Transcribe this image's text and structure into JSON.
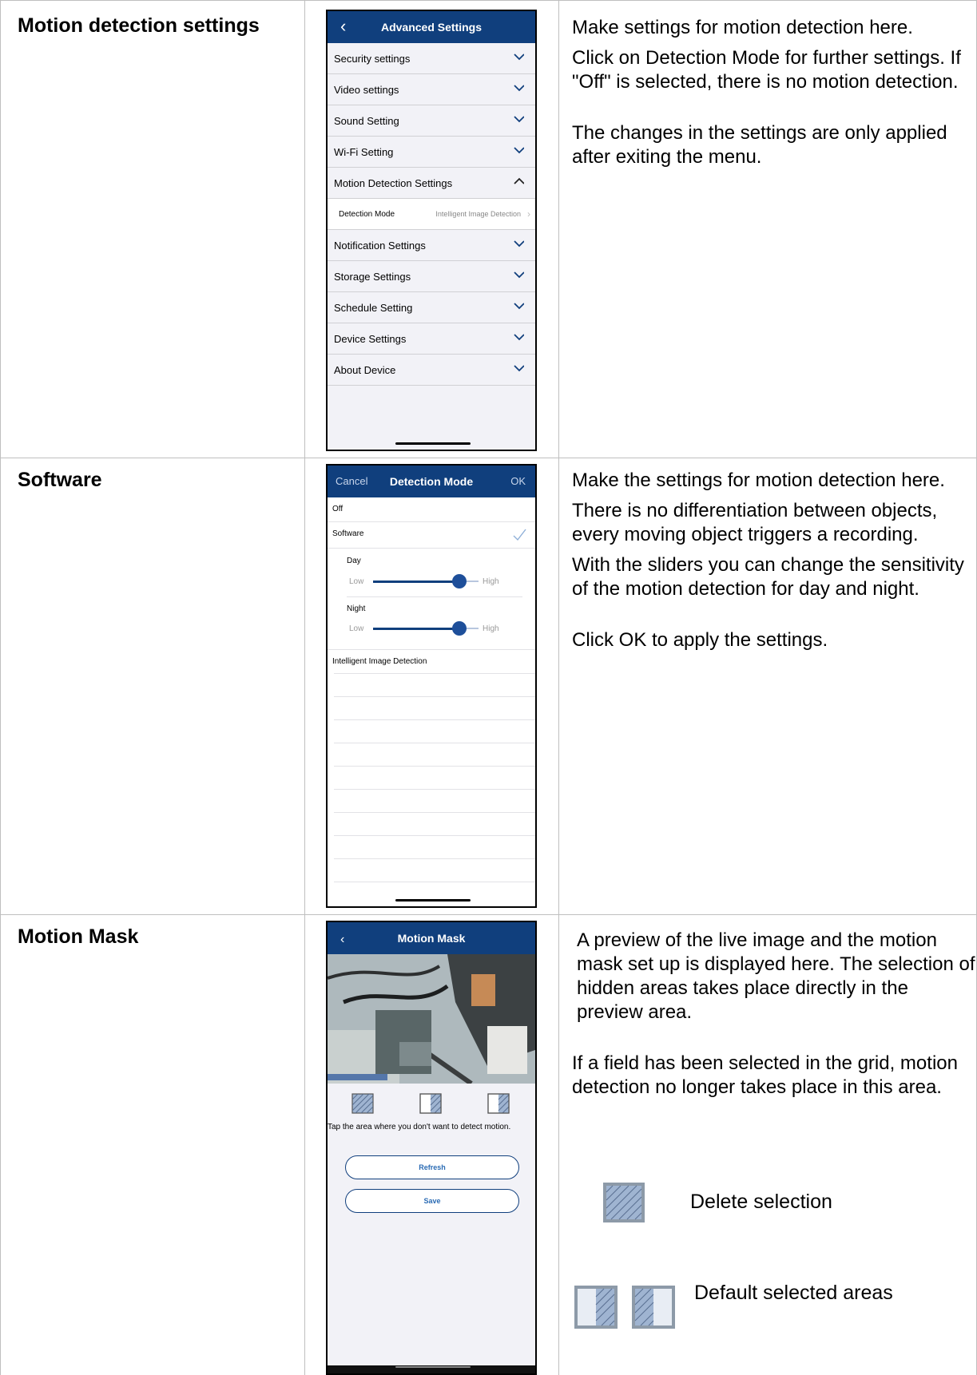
{
  "rows": [
    {
      "title": "Motion detection settings",
      "description": [
        "Make settings for motion detection here.",
        "Click on Detection Mode for further settings. If \"Off\" is selected, there is no motion detection.",
        "The changes in the settings are only applied after exiting the menu."
      ]
    },
    {
      "title": "Software",
      "description": [
        "Make the settings for motion detection here.",
        "There is no differentiation between objects, every moving object triggers a recording.",
        "With the sliders you can change the sensitivity of the motion detection for day and night.",
        "Click OK to apply the settings."
      ]
    },
    {
      "title": "Motion Mask",
      "description": [
        "A preview of the live image and the motion mask set up is displayed here. The selection of hidden areas takes place directly in the preview area.",
        "If a field has been selected in the grid, motion detection no longer takes place in this area."
      ],
      "legend": {
        "delete": "Delete selection",
        "default": "Default selected areas"
      }
    }
  ],
  "advanced": {
    "title": "Advanced Settings",
    "items": [
      "Security settings",
      "Video settings",
      "Sound Setting",
      "Wi-Fi Setting",
      "Motion Detection Settings",
      "Notification Settings",
      "Storage Settings",
      "Schedule Setting",
      "Device Settings",
      "About Device"
    ],
    "sub_label": "Detection Mode",
    "sub_value": "Intelligent Image Detection"
  },
  "detection": {
    "cancel": "Cancel",
    "title": "Detection Mode",
    "ok": "OK",
    "off": "Off",
    "software": "Software",
    "day": "Day",
    "night": "Night",
    "low": "Low",
    "high": "High",
    "intelligent": "Intelligent Image Detection",
    "day_level": 0.82,
    "night_level": 0.82
  },
  "mask": {
    "title": "Motion Mask",
    "hint": "Tap the area where you don't want to detect motion.",
    "refresh": "Refresh",
    "save": "Save"
  },
  "colors": {
    "header": "#103f7d",
    "accent": "#2a6bb4"
  }
}
